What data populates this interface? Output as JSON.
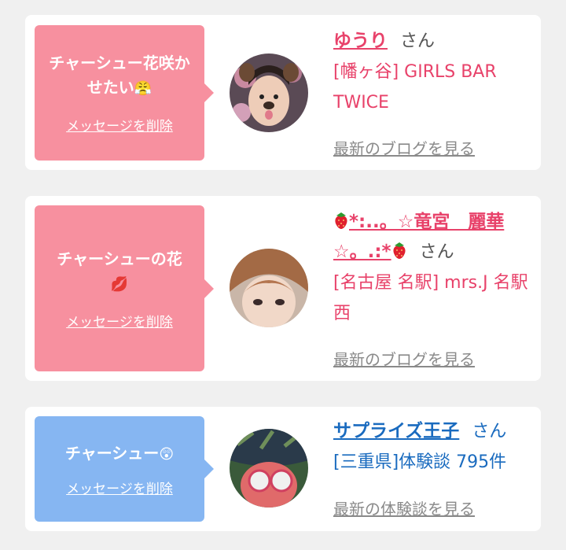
{
  "cards": [
    {
      "message": "チャーシュー花咲かせたい",
      "message_emoji": "😤",
      "delete_label": "メッセージを削除",
      "name": "ゆうり",
      "honorific": "さん",
      "shop": "[幡ヶ谷] GIRLS BAR TWICE",
      "more_label": "最新のブログを見る"
    },
    {
      "message": "チャーシューの花",
      "message_emoji": "💋",
      "delete_label": "メッセージを削除",
      "name": "*:..。☆竜宮　麗華☆。.:*",
      "honorific": "さん",
      "shop": "[名古屋 名駅] mrs.J 名駅西",
      "more_label": "最新のブログを見る"
    },
    {
      "message": "チャーシュー",
      "message_emoji": "😲",
      "delete_label": "メッセージを削除",
      "name": "サプライズ王子",
      "honorific": "さん",
      "shop": "[三重県]体験談 795件",
      "more_label": "最新の体験談を見る"
    }
  ],
  "icons": {
    "name_decoration": "strawberry-icon"
  },
  "colors": {
    "pink_bubble": "#f7909f",
    "blue_bubble": "#86b6f2",
    "pink_text": "#e8426a",
    "blue_text": "#1a6bbf",
    "background": "#f0f0f0"
  }
}
